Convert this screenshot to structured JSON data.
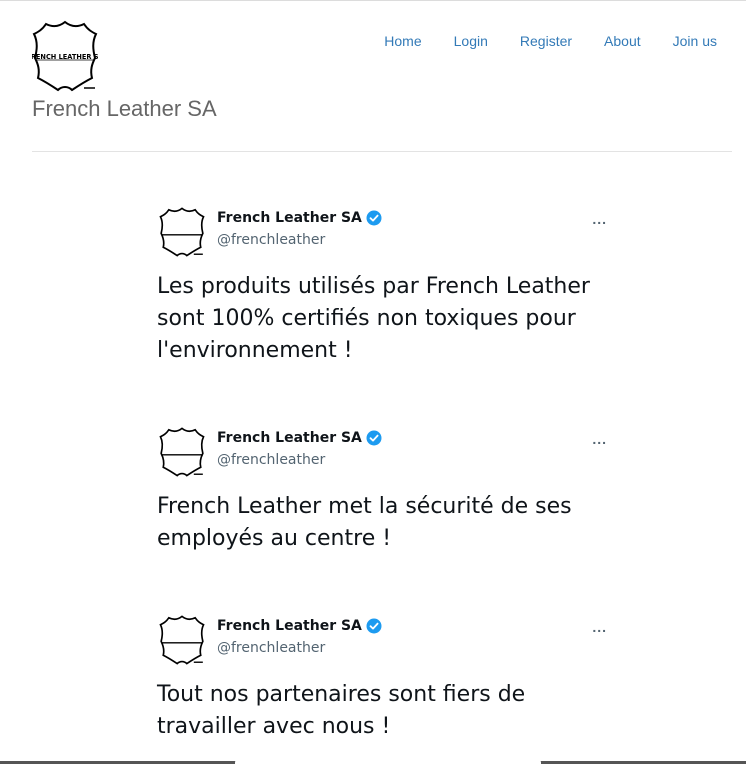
{
  "header": {
    "site_title": "French Leather SA",
    "logo_text": "FRENCH LEATHER SA",
    "nav": [
      "Home",
      "Login",
      "Register",
      "About",
      "Join us"
    ]
  },
  "tweets": [
    {
      "name": "French Leather SA",
      "handle": "@frenchleather",
      "more": "...",
      "text": "Les produits utilisés par French Leather sont 100% certifiés non toxiques pour l'environnement !"
    },
    {
      "name": "French Leather SA",
      "handle": "@frenchleather",
      "more": "...",
      "text": "French Leather met la sécurité de ses employés au centre !"
    },
    {
      "name": "French Leather SA",
      "handle": "@frenchleather",
      "more": "...",
      "text": "Tout nos partenaires sont fiers de travailler avec nous !"
    }
  ],
  "colors": {
    "link": "#337ab7",
    "verified": "#1d9bf0"
  },
  "icons": {
    "verified": "verified-badge-icon",
    "more": "more-options-icon"
  }
}
